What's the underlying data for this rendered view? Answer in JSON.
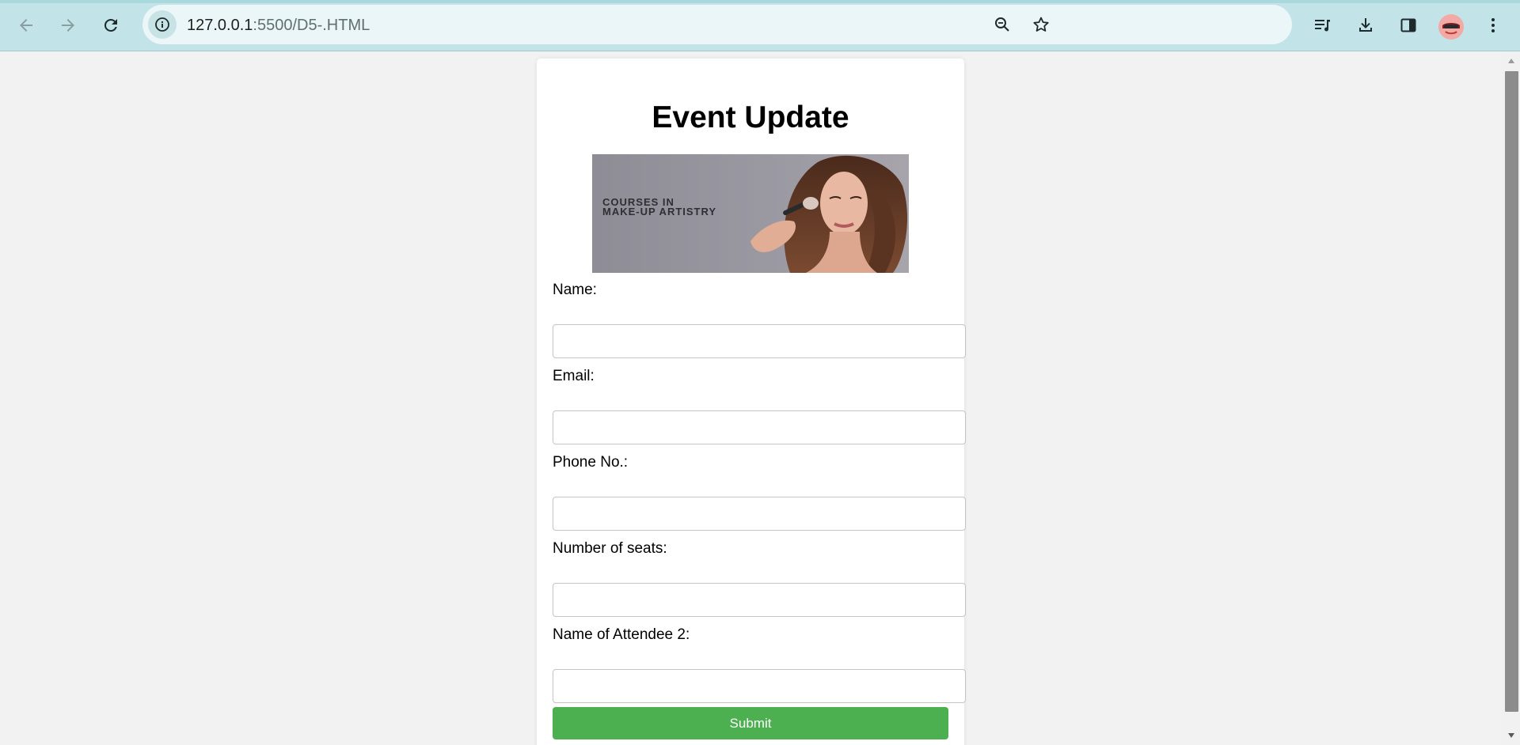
{
  "browser": {
    "url_host": "127.0.0.1",
    "url_path": ":5500/D5-.HTML",
    "icons": {
      "back": "arrow-left-icon",
      "forward": "arrow-right-icon",
      "reload": "reload-icon",
      "site_info": "info-icon",
      "zoom": "zoom-icon",
      "bookmark": "star-icon",
      "media": "media-controls-icon",
      "downloads": "download-icon",
      "side_panel": "side-panel-icon",
      "profile": "avatar",
      "menu": "more-vert-icon"
    },
    "accent_color": "#c2e4e8"
  },
  "page": {
    "title": "Event Update",
    "banner": {
      "line1": "COURSES IN",
      "line2": "MAKE-UP ARTISTRY"
    },
    "fields": [
      {
        "label": "Name:",
        "value": ""
      },
      {
        "label": "Email:",
        "value": ""
      },
      {
        "label": "Phone No.:",
        "value": ""
      },
      {
        "label": "Number of seats:",
        "value": ""
      },
      {
        "label": "Name of Attendee 2:",
        "value": ""
      }
    ],
    "submit_label": "Submit",
    "submit_color": "#4caf50"
  }
}
